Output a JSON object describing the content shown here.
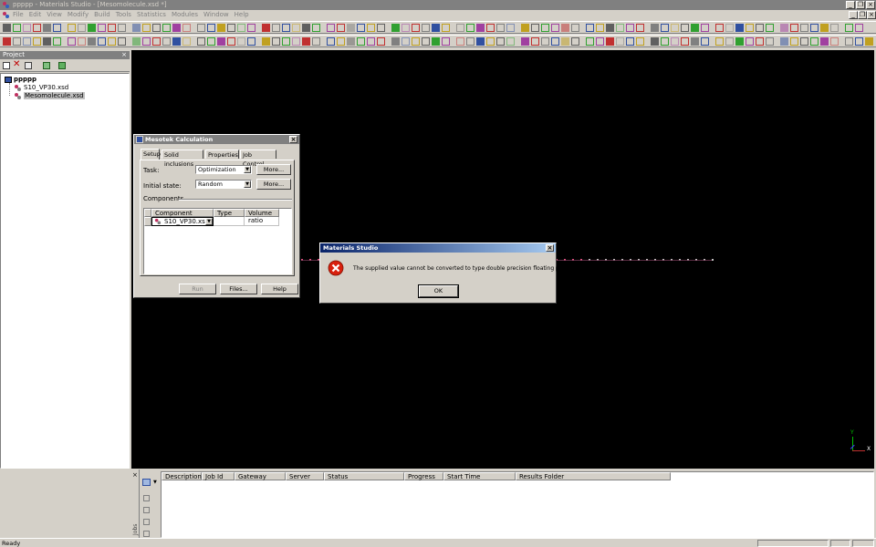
{
  "window": {
    "title": "ppppp - Materials Studio - [Mesomolecule.xsd *]",
    "menus": [
      "File",
      "Edit",
      "View",
      "Modify",
      "Build",
      "Tools",
      "Statistics",
      "Modules",
      "Window",
      "Help"
    ],
    "status": "Ready"
  },
  "project": {
    "header": "Project",
    "root": "ppppp",
    "items": [
      "S10_VP30.xsd",
      "Mesomolecule.xsd"
    ]
  },
  "mesotek": {
    "title": "Mesotek Calculation",
    "tabs": [
      "Setup",
      "Solid inclusions",
      "Properties",
      "Job Control"
    ],
    "task_label": "Task:",
    "task_value": "Optimization",
    "initial_label": "Initial state:",
    "initial_value": "Random",
    "more_label": "More...",
    "components_label": "Components",
    "columns": [
      "Component",
      "Type",
      "Volume ratio"
    ],
    "component_value": "S10_VP30.xsd",
    "run_label": "Run",
    "files_label": "Files...",
    "help_label": "Help"
  },
  "error": {
    "title": "Materials Studio",
    "message": "The supplied value cannot be converted to type double precision floating point.",
    "ok_label": "OK"
  },
  "jobs": {
    "side_label": "Jobs",
    "columns": [
      "Description",
      "Job Id",
      "Gateway",
      "Server",
      "Status",
      "Progress",
      "Start Time",
      "Results Folder"
    ]
  },
  "axis": {
    "y": "Y",
    "x": "X"
  },
  "colors": {
    "accent": "#0a246a",
    "error_red": "#d8200e",
    "bead_pink": "#e05080",
    "bead_gray": "#c0c0c0"
  }
}
